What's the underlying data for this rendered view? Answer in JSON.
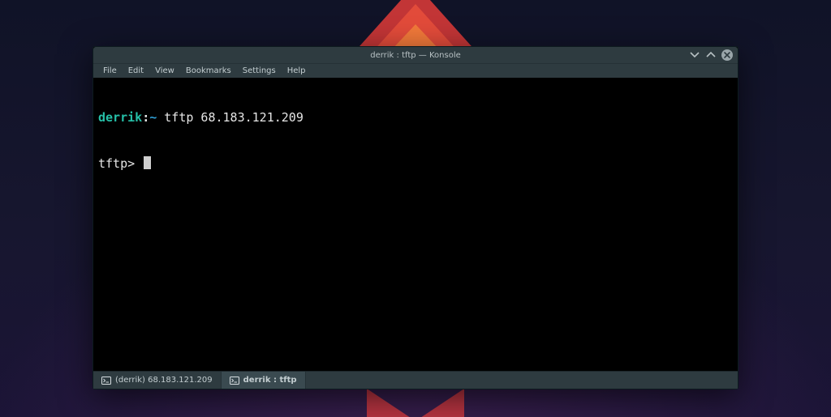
{
  "window": {
    "title": "derrik : tftp — Konsole",
    "menu": [
      "File",
      "Edit",
      "View",
      "Bookmarks",
      "Settings",
      "Help"
    ],
    "tabs": [
      {
        "label": "(derrik) 68.183.121.209",
        "active": false
      },
      {
        "label": "derrik : tftp",
        "active": true
      }
    ]
  },
  "terminal": {
    "prompt_user": "derrik",
    "prompt_sep": ":",
    "prompt_home": "~",
    "command": "tftp 68.183.121.209",
    "line2_prefix": "tftp>"
  }
}
